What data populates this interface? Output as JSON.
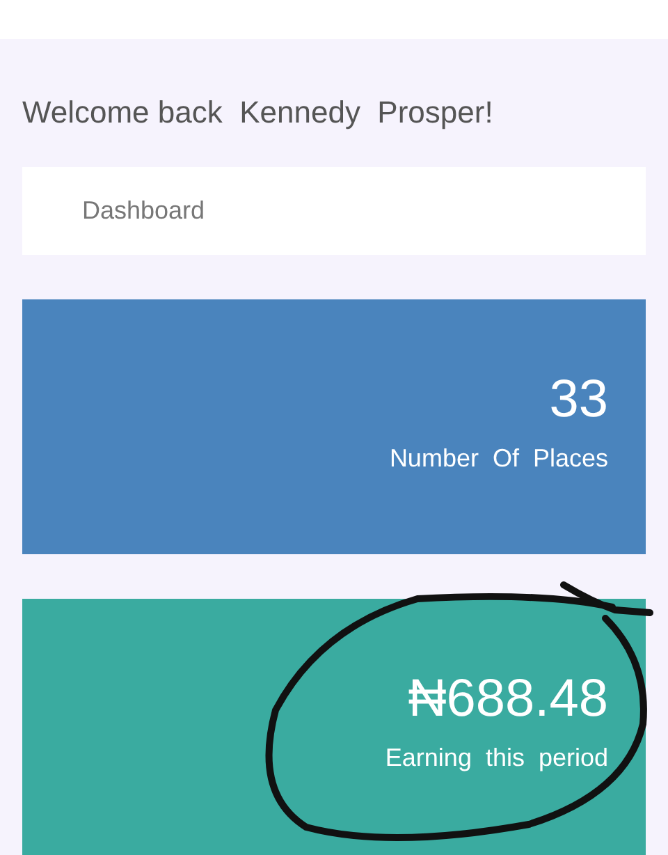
{
  "welcome": "Welcome back  Kennedy  Prosper!",
  "breadcrumb": "Dashboard",
  "stats": [
    {
      "value": "33",
      "label": "Number  Of  Places",
      "color": "#4a84bd"
    },
    {
      "value": "₦688.48",
      "label": "Earning  this  period",
      "color": "#3aaba0"
    }
  ]
}
